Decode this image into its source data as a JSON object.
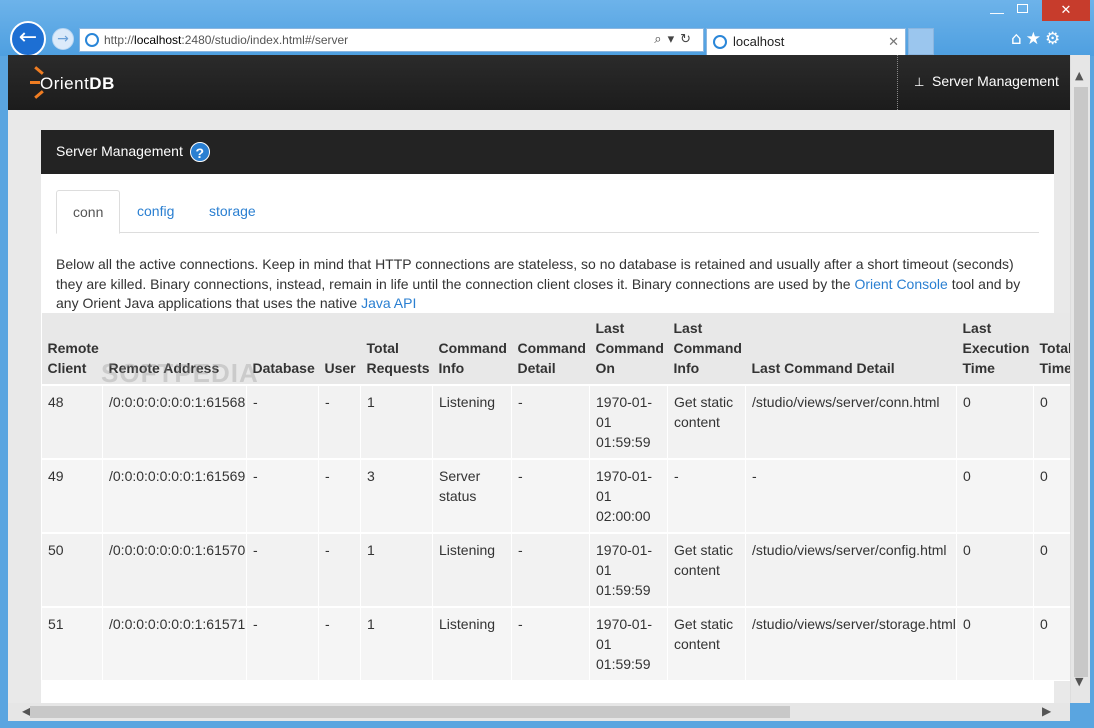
{
  "browser": {
    "url_prefix": "http://",
    "url_host": "localhost",
    "url_rest": ":2480/studio/index.html#/server",
    "tab_title": "localhost",
    "tools_glyphs": "⌕▾↻",
    "close_tab_glyph": "✕",
    "back_glyph": "←",
    "forward_glyph": "→",
    "home_icons": "⌂★⚙"
  },
  "navbar": {
    "brand_prefix": "Orient",
    "brand_suffix": "DB",
    "server_mgmt_label": "Server Management",
    "server_mgmt_icon": "sitemap-icon"
  },
  "panel": {
    "title": "Server Management",
    "help_glyph": "?"
  },
  "tabs": [
    {
      "label": "conn",
      "active": true
    },
    {
      "label": "config",
      "active": false
    },
    {
      "label": "storage",
      "active": false
    }
  ],
  "description": {
    "text1": "Below all the active connections. Keep in mind that HTTP connections are stateless, so no database is retained and usually after a short timeout (seconds) they are killed. Binary connections, instead, remain in life until the connection client closes it. Binary connections are used by the ",
    "link1": "Orient Console",
    "text2": " tool and by any Orient Java applications that uses the native ",
    "link2": "Java API"
  },
  "watermark": "SOFTPEDIA",
  "table": {
    "headers": [
      "Remote Client",
      "Remote Address",
      "Database",
      "User",
      "Total Requests",
      "Command Info",
      "Command Detail",
      "Last Command On",
      "Last Command Info",
      "Last Command Detail",
      "Last Execution Time",
      "Total Working Time"
    ],
    "rows": [
      [
        "48",
        "/0:0:0:0:0:0:0:1:61568",
        "-",
        "-",
        "1",
        "Listening",
        "-",
        "1970-01-01 01:59:59",
        "Get static content",
        "/studio/views/server/conn.html",
        "0",
        "0"
      ],
      [
        "49",
        "/0:0:0:0:0:0:0:1:61569",
        "-",
        "-",
        "3",
        "Server status",
        "-",
        "1970-01-01 02:00:00",
        "-",
        "-",
        "0",
        "0"
      ],
      [
        "50",
        "/0:0:0:0:0:0:0:1:61570",
        "-",
        "-",
        "1",
        "Listening",
        "-",
        "1970-01-01 01:59:59",
        "Get static content",
        "/studio/views/server/config.html",
        "0",
        "0"
      ],
      [
        "51",
        "/0:0:0:0:0:0:0:1:61571",
        "-",
        "-",
        "1",
        "Listening",
        "-",
        "1970-01-01 01:59:59",
        "Get static content",
        "/studio/views/server/storage.html",
        "0",
        "0"
      ]
    ]
  },
  "colors": {
    "accent": "#2a7fd1",
    "navbar": "#1c1c1c",
    "logo_orange": "#f07d22"
  }
}
